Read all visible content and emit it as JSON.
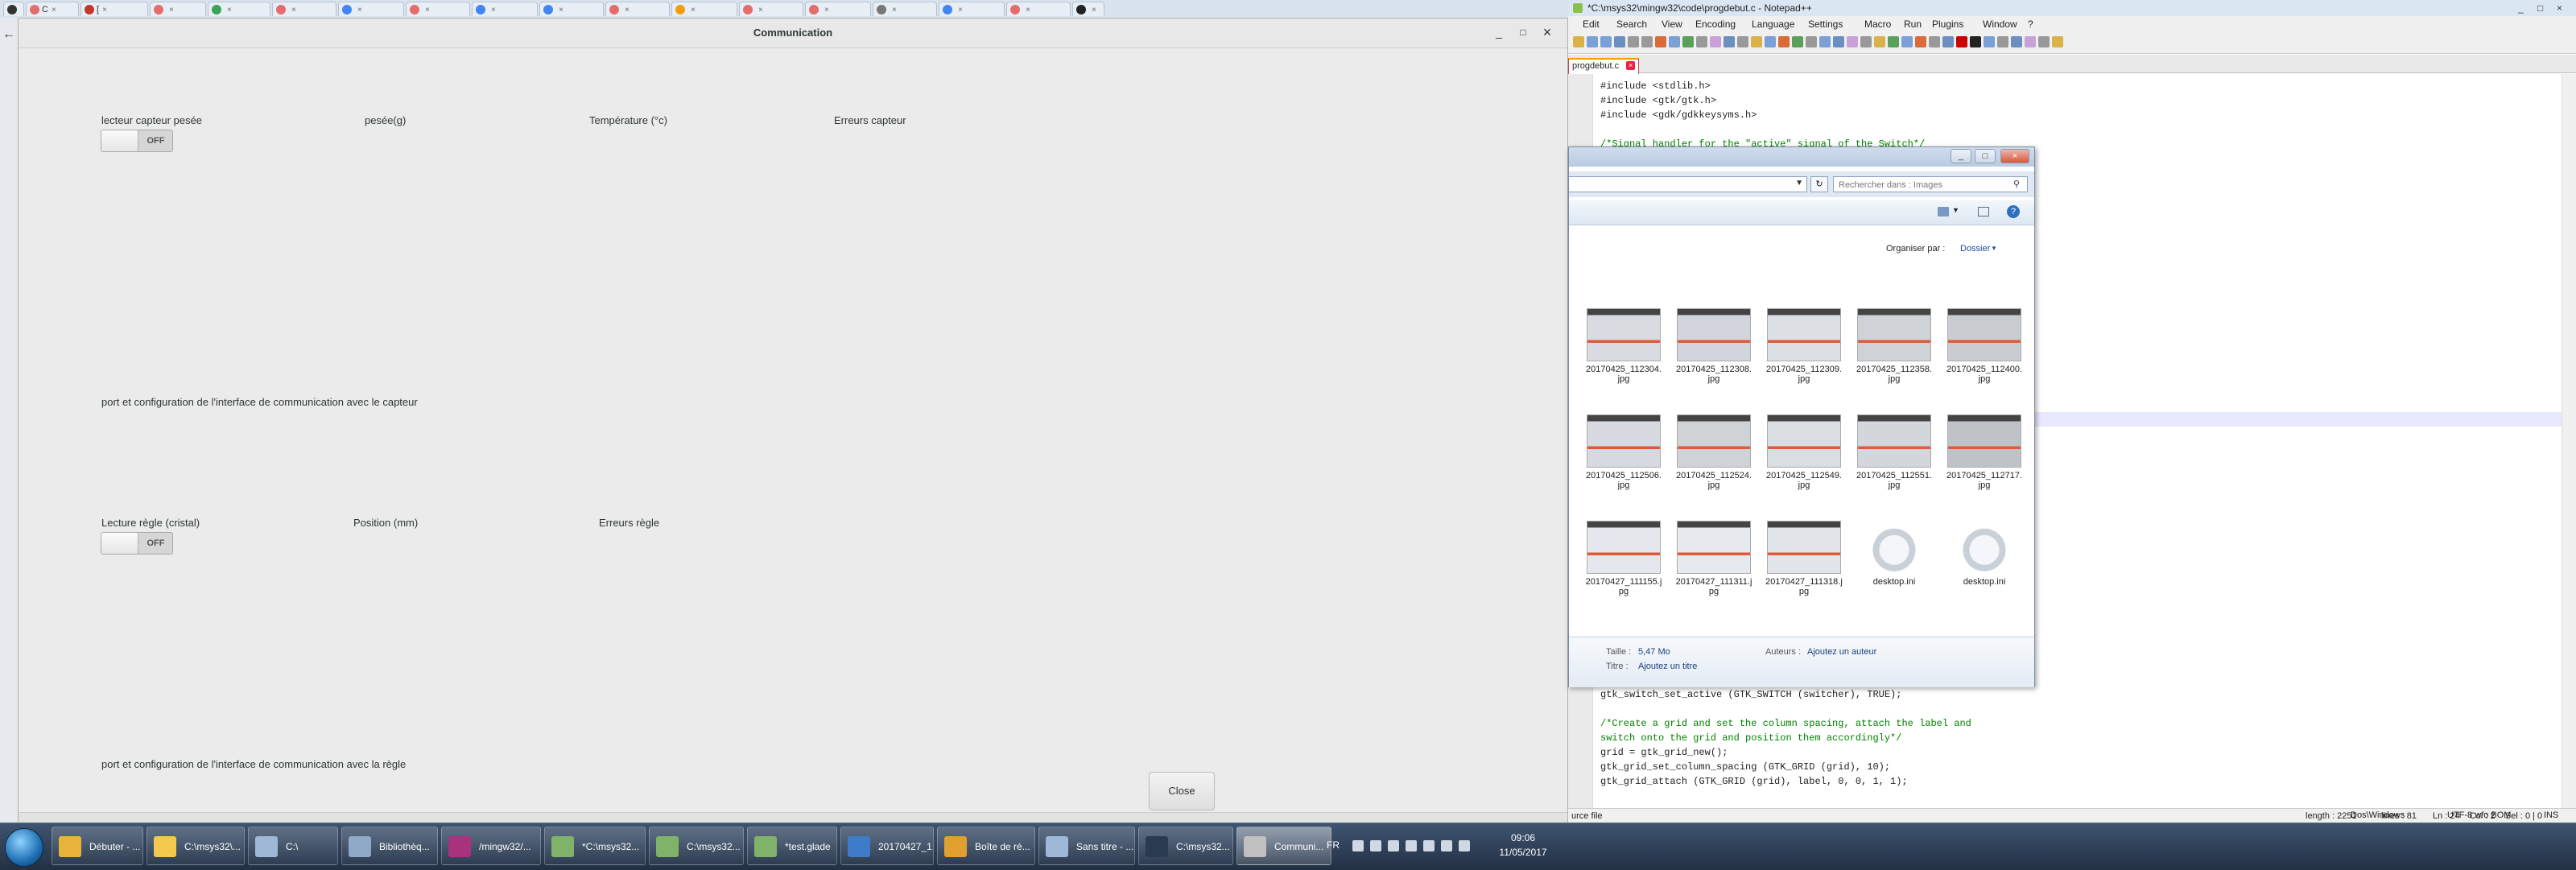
{
  "browser": {
    "tabs": [
      {
        "label": "",
        "color": "#333333"
      },
      {
        "label": "C",
        "color": "#e46c6c"
      },
      {
        "label": "[",
        "color": "#c0392b"
      },
      {
        "label": "",
        "color": "#e46c6c"
      },
      {
        "label": "",
        "color": "#3aa655"
      },
      {
        "label": "",
        "color": "#e46c6c"
      },
      {
        "label": "",
        "color": "#4285f4"
      },
      {
        "label": "",
        "color": "#e46c6c"
      },
      {
        "label": "",
        "color": "#4285f4"
      },
      {
        "label": "",
        "color": "#4285f4"
      },
      {
        "label": "",
        "color": "#e46c6c"
      },
      {
        "label": "",
        "color": "#f39c12"
      },
      {
        "label": "",
        "color": "#e46c6c"
      },
      {
        "label": "",
        "color": "#e46c6c"
      },
      {
        "label": "",
        "color": "#777777"
      },
      {
        "label": "",
        "color": "#4285f4"
      },
      {
        "label": "",
        "color": "#e46c6c"
      },
      {
        "label": "",
        "color": "#222222"
      }
    ],
    "back_icon": "back-arrow-icon"
  },
  "gtk": {
    "title": "Communication",
    "minimize": "_",
    "maximize": "□",
    "close": "×",
    "section1": {
      "col1": "lecteur capteur pesée",
      "col2": "pesée(g)",
      "col3": "Température (°c)",
      "col4": "Erreurs capteur",
      "switch_state": "OFF",
      "footer": "port et configuration de l'interface de communication avec le capteur"
    },
    "section2": {
      "col1": "Lecture règle (cristal)",
      "col2": "Position (mm)",
      "col3": "Erreurs règle",
      "switch_state": "OFF",
      "footer": "port et configuration de l'interface de communication avec la règle"
    },
    "close_button": "Close"
  },
  "npp": {
    "title": "*C:\\msys32\\mingw32\\code\\progdebut.c - Notepad++",
    "menu": [
      "Edit",
      "Search",
      "View",
      "Encoding",
      "Language",
      "Settings",
      "Macro",
      "Run",
      "Plugins",
      "Window",
      "?"
    ],
    "tab_label": "progdebut.c",
    "code_top": [
      "#include <stdlib.h>",
      "#include <gtk/gtk.h>",
      "#include <gdk/gdkkeysyms.h>",
      "",
      "/*Signal handler for the \"active\" signal of the Switch*/"
    ],
    "code_bottom": [
      "gtk_switch_set_active (GTK_SWITCH (switcher), TRUE);",
      "",
      "/*Create a grid and set the column spacing, attach the label and",
      "switch onto the grid and position them accordingly*/",
      "grid = gtk_grid_new();",
      "gtk_grid_set_column_spacing (GTK_GRID (grid), 10);",
      "gtk_grid_attach (GTK_GRID (grid), label, 0, 0, 1, 1);"
    ],
    "status": {
      "file_type": "urce file",
      "length": "length : 2251",
      "lines": "lines : 81",
      "position": "Ln : 24    Col : 2    Sel : 0 | 0",
      "eol": "Dos\\Windows",
      "encoding": "UTF-8 w/o BOM",
      "mode": "INS"
    }
  },
  "explorer": {
    "search_placeholder": "Rechercher dans : Images",
    "arrange_label": "Organiser par :",
    "arrange_value": "Dossier",
    "files": [
      {
        "name": "20170425_112304.jpg",
        "kind": "photo"
      },
      {
        "name": "20170425_112308.jpg",
        "kind": "photo"
      },
      {
        "name": "20170425_112309.jpg",
        "kind": "photo"
      },
      {
        "name": "20170425_112358.jpg",
        "kind": "photo"
      },
      {
        "name": "20170425_112400.jpg",
        "kind": "photo"
      },
      {
        "name": "20170425_112506.jpg",
        "kind": "photo"
      },
      {
        "name": "20170425_112524.jpg",
        "kind": "photo"
      },
      {
        "name": "20170425_112549.jpg",
        "kind": "photo"
      },
      {
        "name": "20170425_112551.jpg",
        "kind": "photo"
      },
      {
        "name": "20170425_112717.jpg",
        "kind": "photo"
      },
      {
        "name": "20170427_111155.jpg",
        "kind": "photo"
      },
      {
        "name": "20170427_111311.jpg",
        "kind": "photo"
      },
      {
        "name": "20170427_111318.jpg",
        "kind": "photo"
      },
      {
        "name": "desktop.ini",
        "kind": "ini"
      },
      {
        "name": "desktop.ini",
        "kind": "ini"
      }
    ],
    "details": {
      "size_label": "Taille :",
      "size_value": "5,47 Mo",
      "authors_label": "Auteurs :",
      "authors_value": "Ajoutez un auteur",
      "title_label": "Titre :",
      "title_value": "Ajoutez un titre"
    }
  },
  "taskbar": {
    "tasks": [
      {
        "label": "Débuter - ...",
        "color": "#e8b33a"
      },
      {
        "label": "C:\\msys32\\...",
        "color": "#f2c94c"
      },
      {
        "label": "C:\\",
        "color": "#9fb8d8"
      },
      {
        "label": "Bibliothèq...",
        "color": "#8fa9c9"
      },
      {
        "label": "/mingw32/...",
        "color": "#a8327d"
      },
      {
        "label": "*C:\\msys32...",
        "color": "#7fb36a"
      },
      {
        "label": "C:\\msys32...",
        "color": "#7fb36a"
      },
      {
        "label": "*test.glade",
        "color": "#7fb36a"
      },
      {
        "label": "20170427_1...",
        "color": "#3e7cc9"
      },
      {
        "label": "Boîte de ré...",
        "color": "#e0a030"
      },
      {
        "label": "Sans titre - ...",
        "color": "#9fb8d8"
      },
      {
        "label": "C:\\msys32...",
        "color": "#2a3b4f"
      },
      {
        "label": "Communi...",
        "color": "#c0c0c0"
      }
    ],
    "lang": "FR",
    "time": "09:06",
    "date": "11/05/2017"
  }
}
